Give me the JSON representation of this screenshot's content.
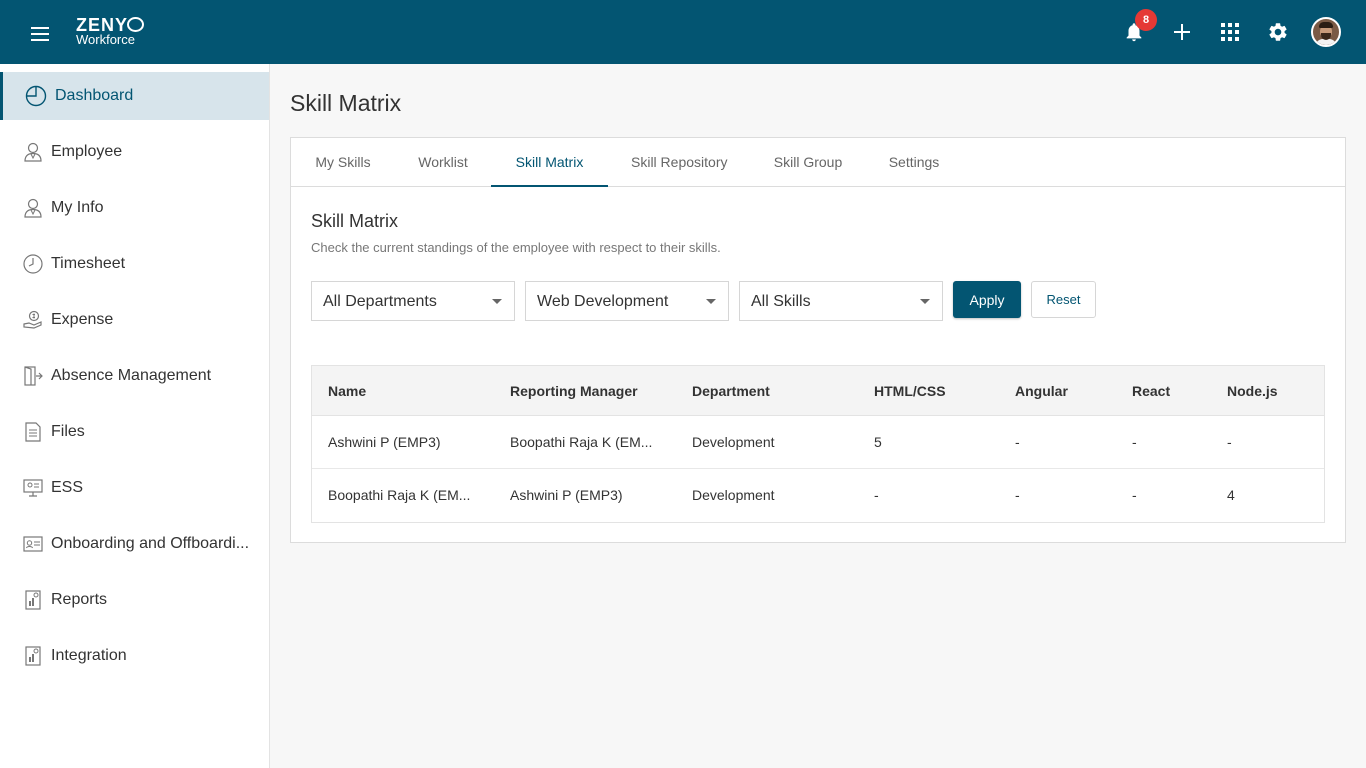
{
  "app": {
    "logo_main": "ZENY",
    "logo_sub": "Workforce",
    "notifications_count": "8"
  },
  "sidebar": {
    "items": [
      {
        "label": "Dashboard",
        "icon": "dashboard-icon",
        "active": true
      },
      {
        "label": "Employee",
        "icon": "employee-icon"
      },
      {
        "label": "My Info",
        "icon": "my-info-icon"
      },
      {
        "label": "Timesheet",
        "icon": "clock-icon"
      },
      {
        "label": "Expense",
        "icon": "expense-icon"
      },
      {
        "label": "Absence Management",
        "icon": "exit-door-icon"
      },
      {
        "label": "Files",
        "icon": "file-icon"
      },
      {
        "label": "ESS",
        "icon": "ess-icon"
      },
      {
        "label": "Onboarding and Offboardi...",
        "icon": "id-card-icon"
      },
      {
        "label": "Reports",
        "icon": "report-icon"
      },
      {
        "label": "Integration",
        "icon": "integration-icon"
      }
    ]
  },
  "page": {
    "title": "Skill Matrix"
  },
  "tabs": [
    {
      "label": "My Skills"
    },
    {
      "label": "Worklist"
    },
    {
      "label": "Skill Matrix",
      "active": true
    },
    {
      "label": "Skill Repository"
    },
    {
      "label": "Skill Group"
    },
    {
      "label": "Settings"
    }
  ],
  "section": {
    "title": "Skill Matrix",
    "description": "Check the current standings of the employee with respect to their skills."
  },
  "filters": {
    "department": "All Departments",
    "skill_group": "Web Development",
    "skill": "All Skills",
    "apply_label": "Apply",
    "reset_label": "Reset"
  },
  "table": {
    "columns": [
      "Name",
      "Reporting Manager",
      "Department",
      "HTML/CSS",
      "Angular",
      "React",
      "Node.js"
    ],
    "rows": [
      [
        "Ashwini P (EMP3)",
        "Boopathi Raja K (EM...",
        "Development",
        "5",
        "-",
        "-",
        "-"
      ],
      [
        "Boopathi Raja K (EM...",
        "Ashwini P (EMP3)",
        "Development",
        "-",
        "-",
        "-",
        "4"
      ]
    ]
  },
  "colors": {
    "brand": "#035572",
    "accent": "#f39c12",
    "badge": "#e53935"
  }
}
